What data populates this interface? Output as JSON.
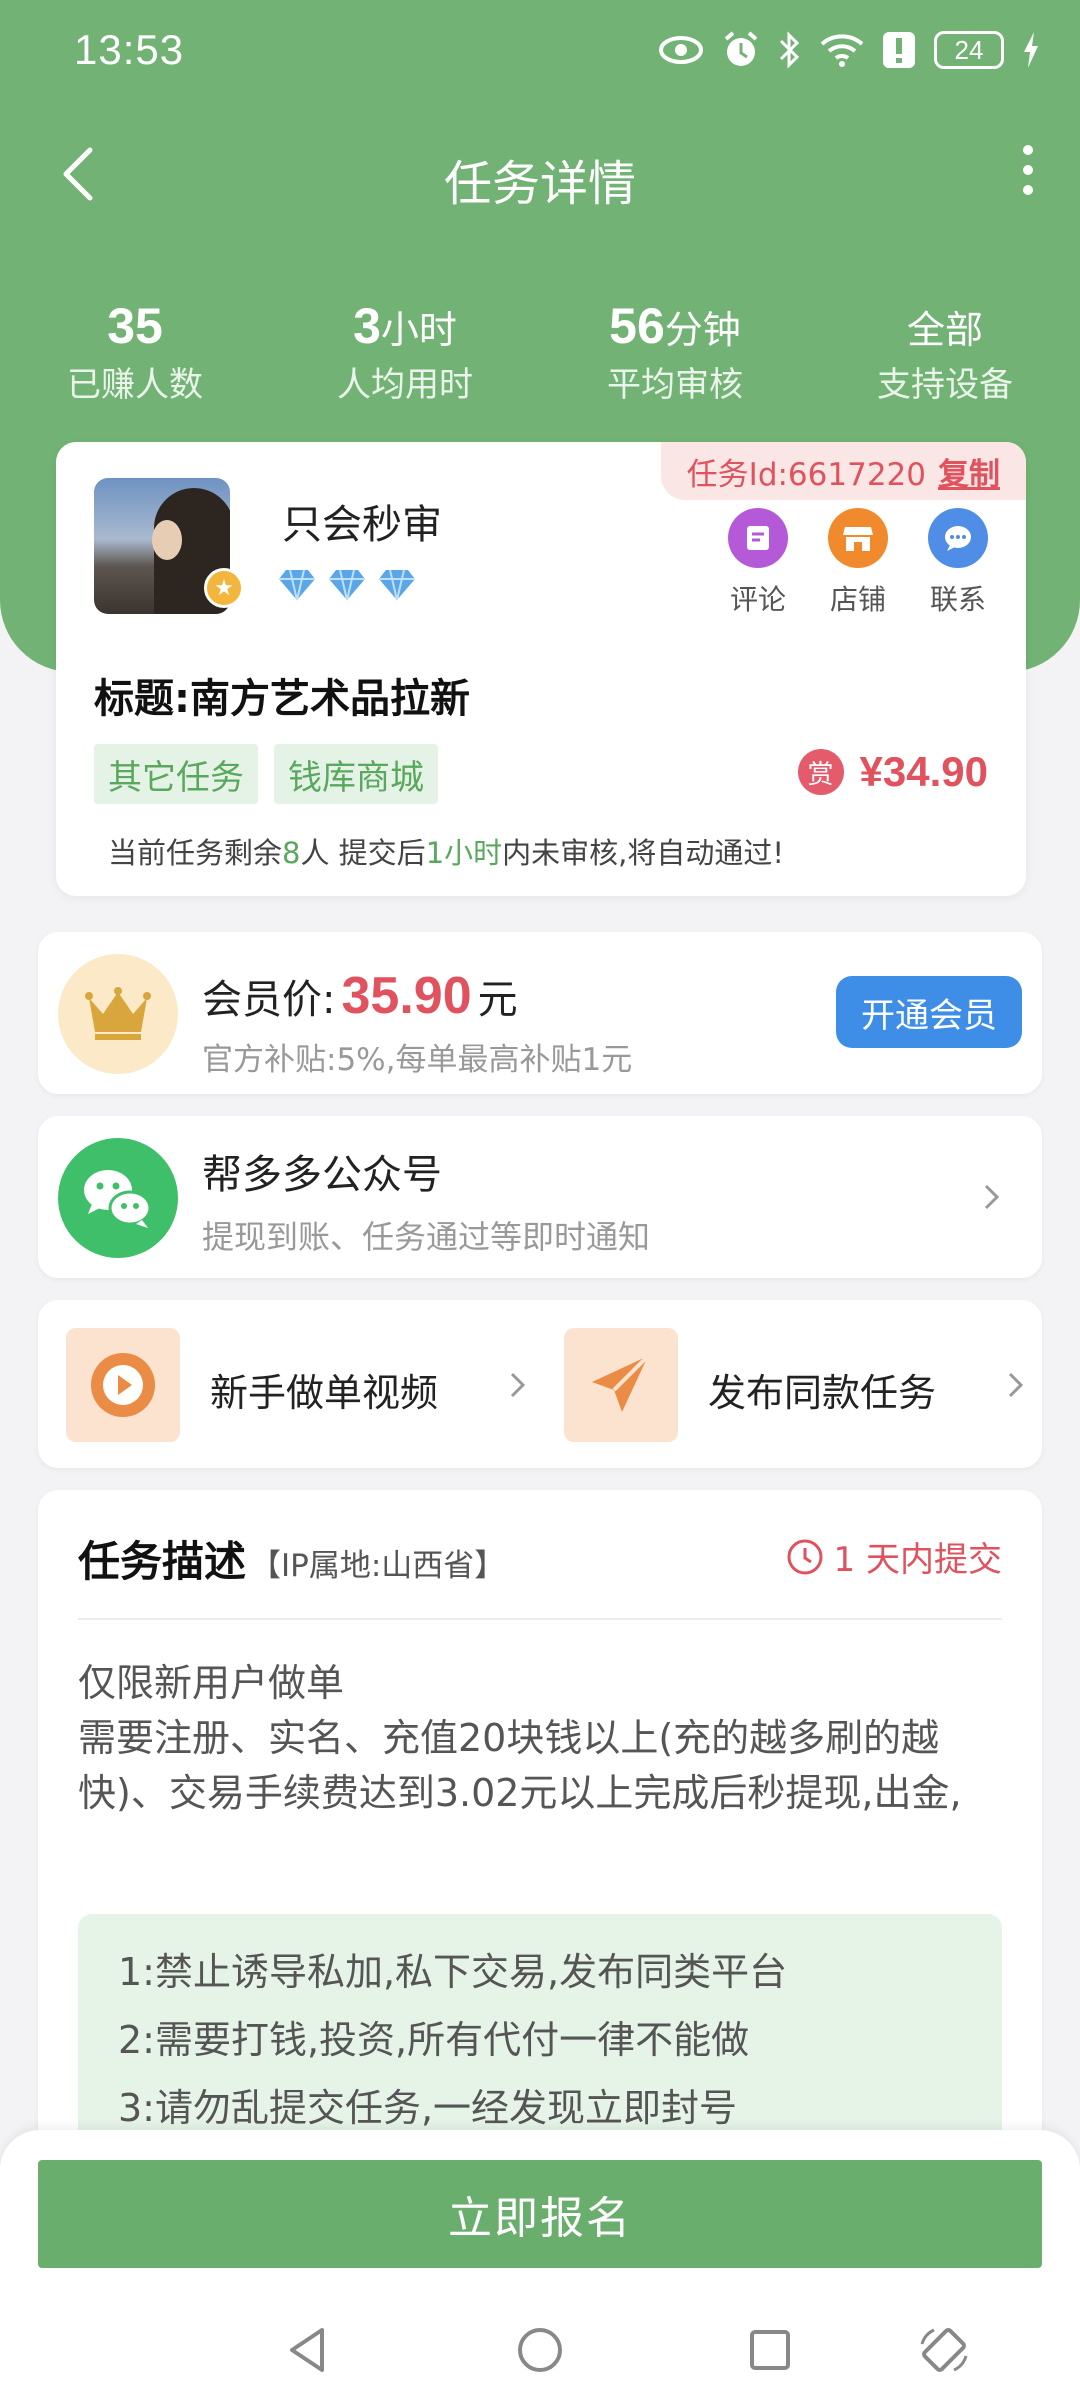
{
  "status_bar": {
    "time": "13:53",
    "battery": "24"
  },
  "nav": {
    "title": "任务详情"
  },
  "stats": [
    {
      "value": "35",
      "unit": "",
      "label": "已赚人数"
    },
    {
      "value": "3",
      "unit": "小时",
      "label": "人均用时"
    },
    {
      "value": "56",
      "unit": "分钟",
      "label": "平均审核"
    },
    {
      "value": "",
      "unit": "全部",
      "label": "支持设备"
    }
  ],
  "task": {
    "id_label": "任务Id:6617220",
    "copy_label": "复制",
    "username": "只会秒审",
    "actions": [
      {
        "label": "评论",
        "icon": "comment-icon",
        "color": "#b45ad8"
      },
      {
        "label": "店铺",
        "icon": "store-icon",
        "color": "#f08a2c"
      },
      {
        "label": "联系",
        "icon": "chat-icon",
        "color": "#4f8de6"
      }
    ],
    "title": "标题:南方艺术品拉新",
    "tags": [
      "其它任务",
      "钱库商城"
    ],
    "reward_badge": "赏",
    "reward": "¥34.90",
    "remain_prefix": "当前任务剩余",
    "remain_count": "8",
    "remain_mid": "人  提交后",
    "remain_time": "1小时",
    "remain_suffix": "内未审核,将自动通过!"
  },
  "member": {
    "label": "会员价:",
    "price": "35.90",
    "unit": "元",
    "sub": "官方补贴:5%,每单最高补贴1元",
    "button": "开通会员"
  },
  "wechat": {
    "title": "帮多多公众号",
    "sub": "提现到账、任务通过等即时通知"
  },
  "links": [
    {
      "label": "新手做单视频",
      "icon": "play-icon"
    },
    {
      "label": "发布同款任务",
      "icon": "send-icon"
    }
  ],
  "description": {
    "heading": "任务描述",
    "ip": "【IP属地:山西省】",
    "deadline": "1 天内提交",
    "body": [
      "仅限新用户做单",
      "需要注册、实名、充值20块钱以上(充的越多刷的越快)、交易手续费达到3.02元以上完成后秒提现,出金,"
    ],
    "rules": [
      "1:禁止诱导私加,私下交易,发布同类平台",
      "2:需要打钱,投资,所有代付一律不能做",
      "3:请勿乱提交任务,一经发现立即封号"
    ]
  },
  "signup_button": "立即报名",
  "colors": {
    "primary_green": "#72b375",
    "price_red": "#e0525d",
    "member_blue": "#3e8ee8"
  }
}
